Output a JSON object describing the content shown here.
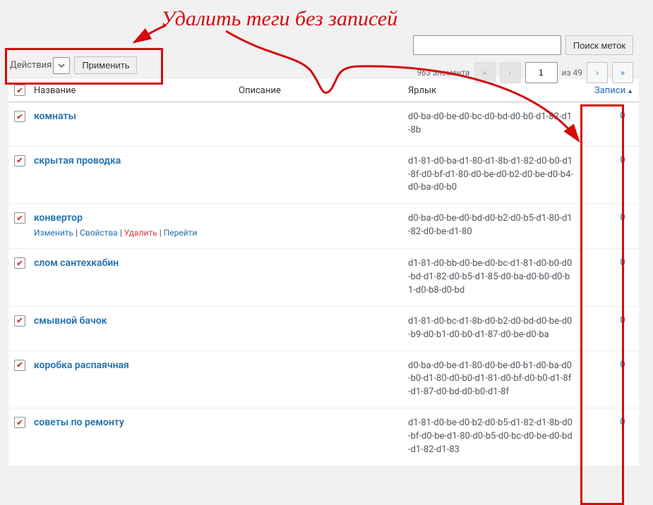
{
  "annotation": {
    "title": "Удалить теги без записей"
  },
  "toolbar": {
    "bulk_label": "Действия",
    "apply_label": "Применить"
  },
  "search": {
    "button_label": "Поиск меток",
    "placeholder": ""
  },
  "pagination": {
    "total_text": "963 элемента",
    "current_page": "1",
    "total_pages_text": "из 49"
  },
  "columns": {
    "name": "Название",
    "description": "Описание",
    "slug": "Ярлык",
    "count": "Записи"
  },
  "row_actions": {
    "edit": "Изменить",
    "quick_edit": "Свойства",
    "delete": "Удалить",
    "view": "Перейти"
  },
  "rows": [
    {
      "name": "комнаты",
      "slug": "d0-ba-d0-be-d0-bc-d0-bd-d0-b0-d1-82-d1-8b",
      "count": "0",
      "show_actions": false
    },
    {
      "name": "скрытая проводка",
      "slug": "d1-81-d0-ba-d1-80-d1-8b-d1-82-d0-b0-d1-8f-d0-bf-d1-80-d0-be-d0-b2-d0-be-d0-b4-d0-ba-d0-b0",
      "count": "0",
      "show_actions": false
    },
    {
      "name": "конвертор",
      "slug": "d0-ba-d0-be-d0-bd-d0-b2-d0-b5-d1-80-d1-82-d0-be-d1-80",
      "count": "0",
      "show_actions": true
    },
    {
      "name": "слом сантехкабин",
      "slug": "d1-81-d0-bb-d0-be-d0-bc-d1-81-d0-b0-d0-bd-d1-82-d0-b5-d1-85-d0-ba-d0-b0-d0-b1-d0-b8-d0-bd",
      "count": "0",
      "show_actions": false
    },
    {
      "name": "смывной бачок",
      "slug": "d1-81-d0-bc-d1-8b-d0-b2-d0-bd-d0-be-d0-b9-d0-b1-d0-b0-d1-87-d0-be-d0-ba",
      "count": "0",
      "show_actions": false
    },
    {
      "name": "коробка распаячная",
      "slug": "d0-ba-d0-be-d1-80-d0-be-d0-b1-d0-ba-d0-b0-d1-80-d0-b0-d1-81-d0-bf-d0-b0-d1-8f-d1-87-d0-bd-d0-b0-d1-8f",
      "count": "0",
      "show_actions": false
    },
    {
      "name": "советы по ремонту",
      "slug": "d1-81-d0-be-d0-b2-d0-b5-d1-82-d1-8b-d0-bf-d0-be-d1-80-d0-b5-d0-bc-d0-be-d0-bd-d1-82-d1-83",
      "count": "0",
      "show_actions": false
    }
  ]
}
